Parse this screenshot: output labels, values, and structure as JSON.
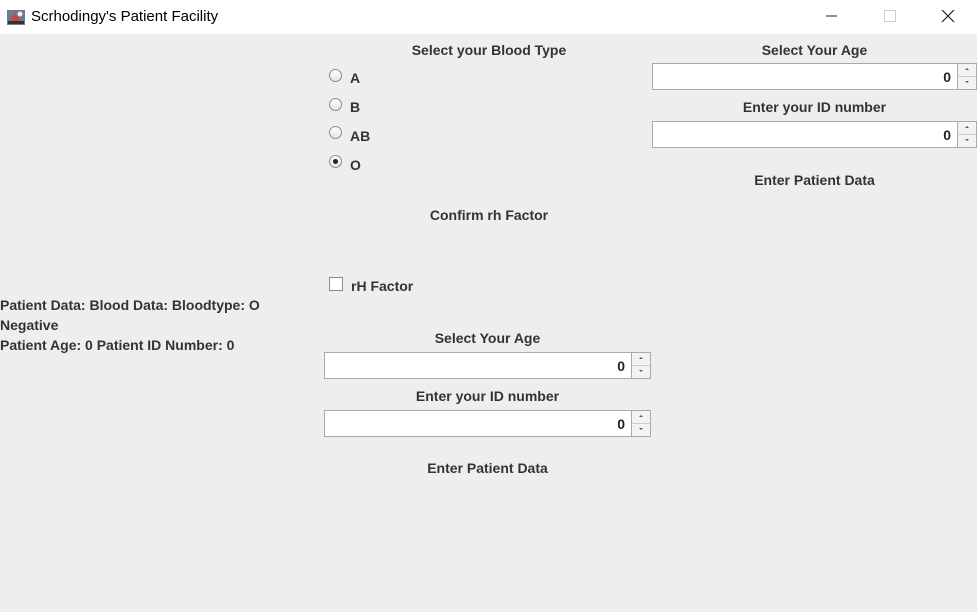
{
  "window": {
    "title": "Scrhodingy's Patient Facility",
    "icon": "java-app-icon",
    "controls": [
      "minimize-icon",
      "maximize-icon",
      "close-icon"
    ]
  },
  "blood_type": {
    "heading": "Select your Blood Type",
    "options": [
      {
        "label": "A",
        "checked": false
      },
      {
        "label": "B",
        "checked": false
      },
      {
        "label": "AB",
        "checked": false
      },
      {
        "label": "O",
        "checked": true
      }
    ]
  },
  "rh": {
    "heading": "Confirm rh Factor",
    "checkbox_label": "rH Factor",
    "checked": false
  },
  "right_panel": {
    "age_heading": "Select Your Age",
    "age_value": "0",
    "id_heading": "Enter your ID number",
    "id_value": "0",
    "submit_label": "Enter Patient Data"
  },
  "center_panel": {
    "age_heading": "Select Your Age",
    "age_value": "0",
    "id_heading": "Enter your ID number",
    "id_value": "0",
    "submit_label": "Enter Patient Data"
  },
  "patient_output": {
    "line1": "Patient Data: Blood Data: Bloodtype: O",
    "line2": "Negative",
    "line3": "Patient Age: 0 Patient ID Number: 0"
  }
}
